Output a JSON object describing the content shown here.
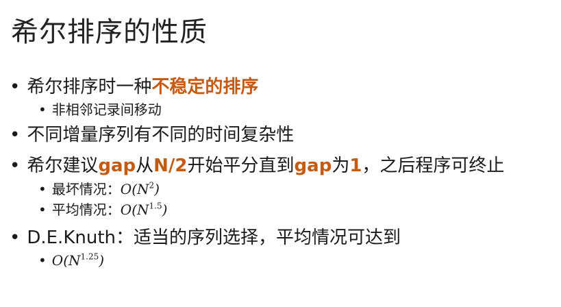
{
  "title": "希尔排序的性质",
  "bullet_symbol": "•",
  "items": [
    {
      "pre": "希尔排序时一种",
      "hl": "不稳定的排序"
    },
    {
      "text": "非相邻记录间移动"
    },
    {
      "text": "不同增量序列有不同的时间复杂性"
    },
    {
      "a": "希尔建议",
      "b": "gap",
      "c": "从",
      "d": "N/2",
      "e": "开始平分直到",
      "f": "gap",
      "g": "为",
      "h": "1",
      "i": "，之后程序可终止"
    },
    {
      "label": "最坏情况：",
      "math_pre": "O(N",
      "exp": "2",
      "math_post": ")"
    },
    {
      "label": "平均情况：",
      "math_pre": "O(N",
      "exp": "1.5",
      "math_post": ")"
    },
    {
      "text": "D.E.Knuth：适当的序列选择，平均情况可达到"
    },
    {
      "math_pre": "O(N",
      "exp": "1.25",
      "math_post": ")"
    }
  ]
}
